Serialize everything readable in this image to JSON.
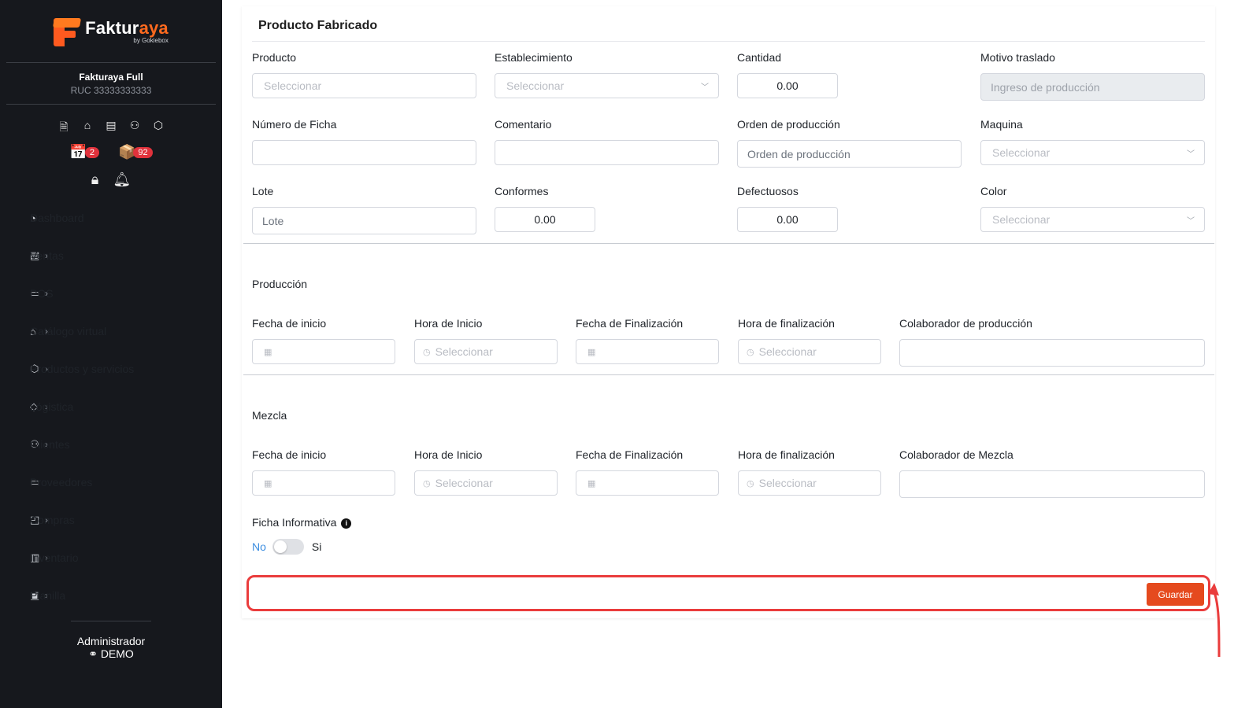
{
  "app": {
    "brand_name_main": "Faktur",
    "brand_name_accent": "aya",
    "brand_sub": "by Gokiebox",
    "company_name": "Fakturaya Full",
    "company_ruc": "RUC 33333333333"
  },
  "sidebar": {
    "badges": [
      {
        "icon": "calendar-x-icon",
        "count": "2"
      },
      {
        "icon": "boxes-icon",
        "count": "92"
      }
    ],
    "items": [
      {
        "label": "Dashboard",
        "icon": "speedometer-icon",
        "has_submenu": false
      },
      {
        "label": "Ventas",
        "icon": "receipt-icon",
        "has_submenu": true
      },
      {
        "label": "POS",
        "icon": "monitor-icon",
        "has_submenu": true
      },
      {
        "label": "Catálogo virtual",
        "icon": "store-icon",
        "has_submenu": true
      },
      {
        "label": "Productos y servicios",
        "icon": "box-icon",
        "has_submenu": true
      },
      {
        "label": "Lógistica",
        "icon": "tag-icon",
        "has_submenu": true
      },
      {
        "label": "Clientes",
        "icon": "users-icon",
        "has_submenu": true
      },
      {
        "label": "Proveedores",
        "icon": "briefcase-icon",
        "has_submenu": false
      },
      {
        "label": "Compras",
        "icon": "shopping-bag-icon",
        "has_submenu": true
      },
      {
        "label": "Inventario",
        "icon": "book-icon",
        "has_submenu": true
      },
      {
        "label": "Planilla",
        "icon": "id-card-icon",
        "has_submenu": true
      }
    ],
    "footer_role": "Administrador",
    "footer_user": "DEMO"
  },
  "form": {
    "section_title": "Producto Fabricado",
    "producto": {
      "label": "Producto",
      "placeholder": "Seleccionar"
    },
    "establecimiento": {
      "label": "Establecimiento",
      "placeholder": "Seleccionar"
    },
    "cantidad": {
      "label": "Cantidad",
      "value": "0.00"
    },
    "motivo": {
      "label": "Motivo traslado",
      "value": "Ingreso de producción"
    },
    "numero_ficha": {
      "label": "Número de Ficha",
      "value": ""
    },
    "comentario": {
      "label": "Comentario",
      "value": ""
    },
    "orden": {
      "label": "Orden de producción",
      "placeholder": "Orden de producción"
    },
    "maquina": {
      "label": "Maquina",
      "placeholder": "Seleccionar"
    },
    "lote": {
      "label": "Lote",
      "placeholder": "Lote"
    },
    "conformes": {
      "label": "Conformes",
      "value": "0.00"
    },
    "defectuosos": {
      "label": "Defectuosos",
      "value": "0.00"
    },
    "color": {
      "label": "Color",
      "placeholder": "Seleccionar"
    }
  },
  "produccion": {
    "title": "Producción",
    "fecha_inicio": "Fecha de inicio",
    "hora_inicio": "Hora de Inicio",
    "fecha_fin": "Fecha de Finalización",
    "hora_fin": "Hora de finalización",
    "colaborador": "Colaborador de producción",
    "time_placeholder": "Seleccionar"
  },
  "mezcla": {
    "title": "Mezcla",
    "fecha_inicio": "Fecha de inicio",
    "hora_inicio": "Hora de Inicio",
    "fecha_fin": "Fecha de Finalización",
    "hora_fin": "Hora de finalización",
    "colaborador": "Colaborador de Mezcla",
    "time_placeholder": "Seleccionar"
  },
  "ficha": {
    "label": "Ficha Informativa",
    "no": "No",
    "si": "Si"
  },
  "actions": {
    "save": "Guardar"
  },
  "colors": {
    "accent": "#e54a1e",
    "highlight": "#ea3c3c",
    "sidebar_bg": "#16181d"
  }
}
